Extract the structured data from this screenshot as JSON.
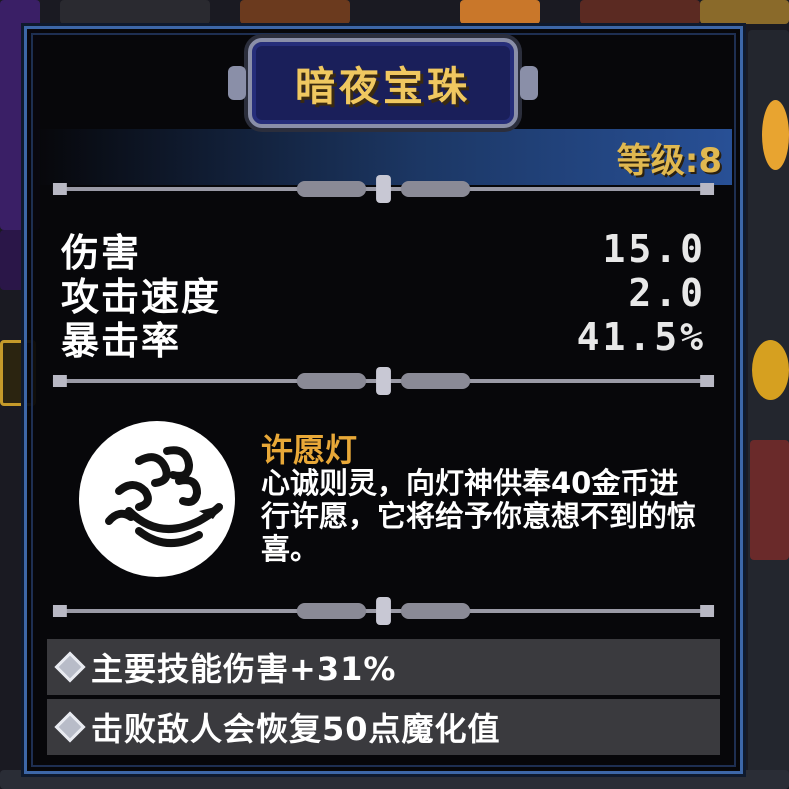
{
  "item": {
    "name": "暗夜宝珠",
    "level_text": "等级:8"
  },
  "stats": [
    {
      "label": "伤害",
      "value": "15.0"
    },
    {
      "label": "攻击速度",
      "value": "2.0"
    },
    {
      "label": "暴击率",
      "value": "41.5%"
    }
  ],
  "skill": {
    "icon": "swirling-cloud-icon",
    "name": "许愿灯",
    "description": "心诚则灵，向灯神供奉40金币进行许愿，它将给予你意想不到的惊喜。"
  },
  "effects": [
    {
      "icon": "diamond-gem-icon",
      "text": "主要技能伤害+31%"
    },
    {
      "icon": "diamond-gem-icon",
      "text": "击败敌人会恢复50点魔化值"
    }
  ],
  "colors": {
    "panel_border": "#3d67a8",
    "title_text": "#f0c860",
    "skill_name": "#e8a838",
    "title_plate": "#1a1f5a"
  }
}
